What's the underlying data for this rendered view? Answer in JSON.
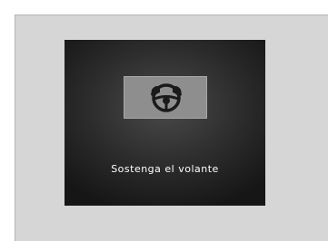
{
  "display": {
    "icon": "hands-on-steering-wheel-icon",
    "message": "Sostenga el volante"
  }
}
